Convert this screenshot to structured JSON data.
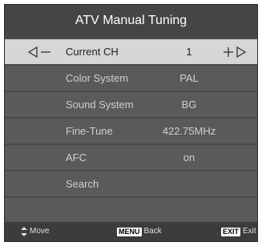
{
  "title": "ATV Manual Tuning",
  "rows": [
    {
      "label": "Current CH",
      "value": "1"
    },
    {
      "label": "Color System",
      "value": "PAL"
    },
    {
      "label": "Sound System",
      "value": "BG"
    },
    {
      "label": "Fine-Tune",
      "value": "422.75MHz"
    },
    {
      "label": "AFC",
      "value": "on"
    },
    {
      "label": "Search",
      "value": ""
    }
  ],
  "footer": {
    "move_label": "Move",
    "menu_key": "MENU",
    "menu_label": "Back",
    "exit_key": "EXIT",
    "exit_label": "Exit"
  },
  "icons": {
    "left_arrow": "left-arrow-minus-icon",
    "right_arrow": "plus-right-arrow-icon",
    "move": "up-down-arrow-icon"
  },
  "colors": {
    "panel": "#4a4a4a",
    "row": "#5a5a5a",
    "selected_row": "#d6d6d6",
    "text": "#cfcfcf"
  }
}
